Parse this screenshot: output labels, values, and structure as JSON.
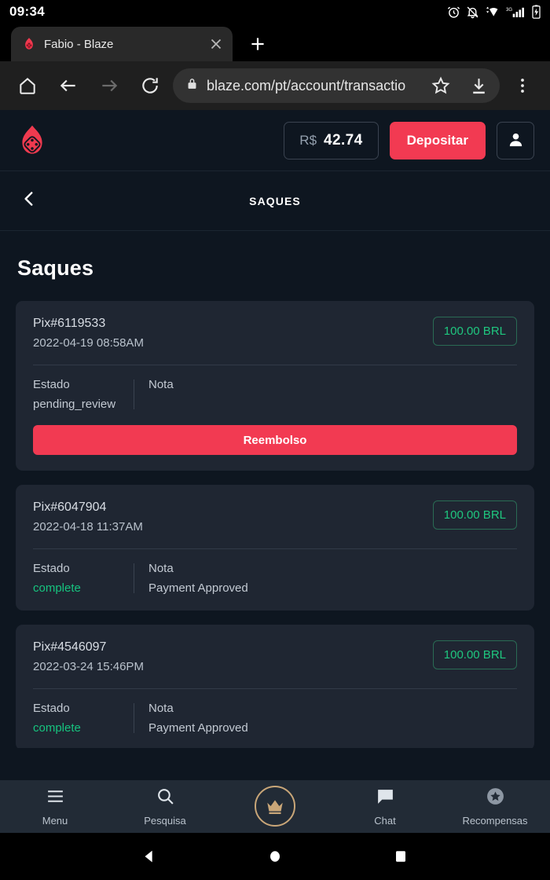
{
  "status_bar": {
    "clock": "09:34",
    "icons": [
      "alarm-icon",
      "bell-muted-icon",
      "wifi-icon",
      "signal-3g-icon",
      "battery-charging-icon"
    ]
  },
  "browser": {
    "tab": {
      "title": "Fabio - Blaze",
      "favicon": "blaze-flame-icon",
      "close_label": "×"
    },
    "new_tab_label": "+",
    "toolbar": {
      "home": "home-icon",
      "back": "back-arrow-icon",
      "forward": "forward-arrow-icon",
      "reload": "reload-icon",
      "lock": "lock-icon",
      "url": "blaze.com/pt/account/transactio",
      "bookmark": "star-icon",
      "download": "download-icon",
      "menu": "overflow-menu-icon"
    }
  },
  "site_header": {
    "logo": "blaze-flame-dice-logo",
    "balance_currency": "R$",
    "balance_value": "42.74",
    "deposit_label": "Depositar",
    "account_icon": "person-icon"
  },
  "sub_header": {
    "back_icon": "chevron-left-icon",
    "title": "SAQUES"
  },
  "main": {
    "page_title": "Saques",
    "labels": {
      "estado": "Estado",
      "nota": "Nota"
    },
    "transactions": [
      {
        "id": "Pix#6119533",
        "date": "2022-04-19 08:58AM",
        "amount": "100.00 BRL",
        "estado": "pending_review",
        "estado_status": "pending",
        "nota": "",
        "action_label": "Reembolso",
        "has_action": true
      },
      {
        "id": "Pix#6047904",
        "date": "2022-04-18 11:37AM",
        "amount": "100.00 BRL",
        "estado": "complete",
        "estado_status": "complete",
        "nota": "Payment Approved",
        "has_action": false
      },
      {
        "id": "Pix#4546097",
        "date": "2022-03-24 15:46PM",
        "amount": "100.00 BRL",
        "estado": "complete",
        "estado_status": "complete",
        "nota": "Payment Approved",
        "has_action": false
      }
    ]
  },
  "bottom_nav": [
    {
      "label": "Menu",
      "icon": "hamburger-menu-icon"
    },
    {
      "label": "Pesquisa",
      "icon": "search-icon"
    },
    {
      "label": "",
      "icon": "crown-icon"
    },
    {
      "label": "Chat",
      "icon": "chat-bubble-icon"
    },
    {
      "label": "Recompensas",
      "icon": "star-circle-icon"
    }
  ],
  "android_nav": [
    "back-triangle-icon",
    "home-circle-icon",
    "recents-square-icon"
  ],
  "colors": {
    "accent_red": "#f23a52",
    "success_green": "#16c47f",
    "amount_green": "#1fc77f",
    "page_bg": "#0e1620",
    "card_bg": "#1f2632",
    "nav_bg": "#222b36",
    "crown_gold": "#c9a678"
  }
}
